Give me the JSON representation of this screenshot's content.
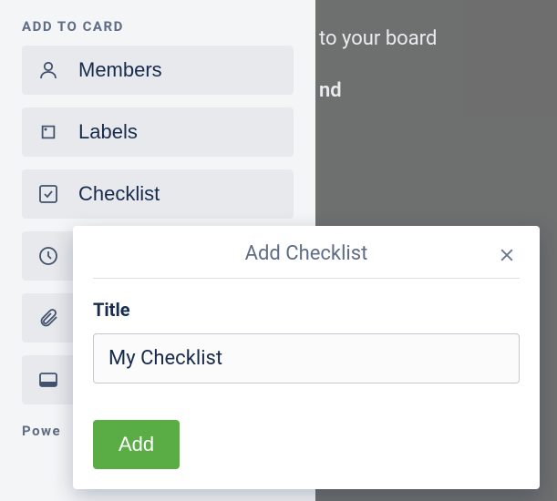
{
  "background": {
    "line1": "to your board",
    "line2": "nd"
  },
  "sidebar": {
    "section_title": "Add to Card",
    "items": [
      {
        "label": "Members"
      },
      {
        "label": "Labels"
      },
      {
        "label": "Checklist"
      },
      {
        "label": ""
      },
      {
        "label": ""
      },
      {
        "label": ""
      }
    ],
    "second_section_title": "Powe"
  },
  "popover": {
    "title": "Add Checklist",
    "field_label": "Title",
    "input_value": "My Checklist",
    "add_label": "Add"
  }
}
